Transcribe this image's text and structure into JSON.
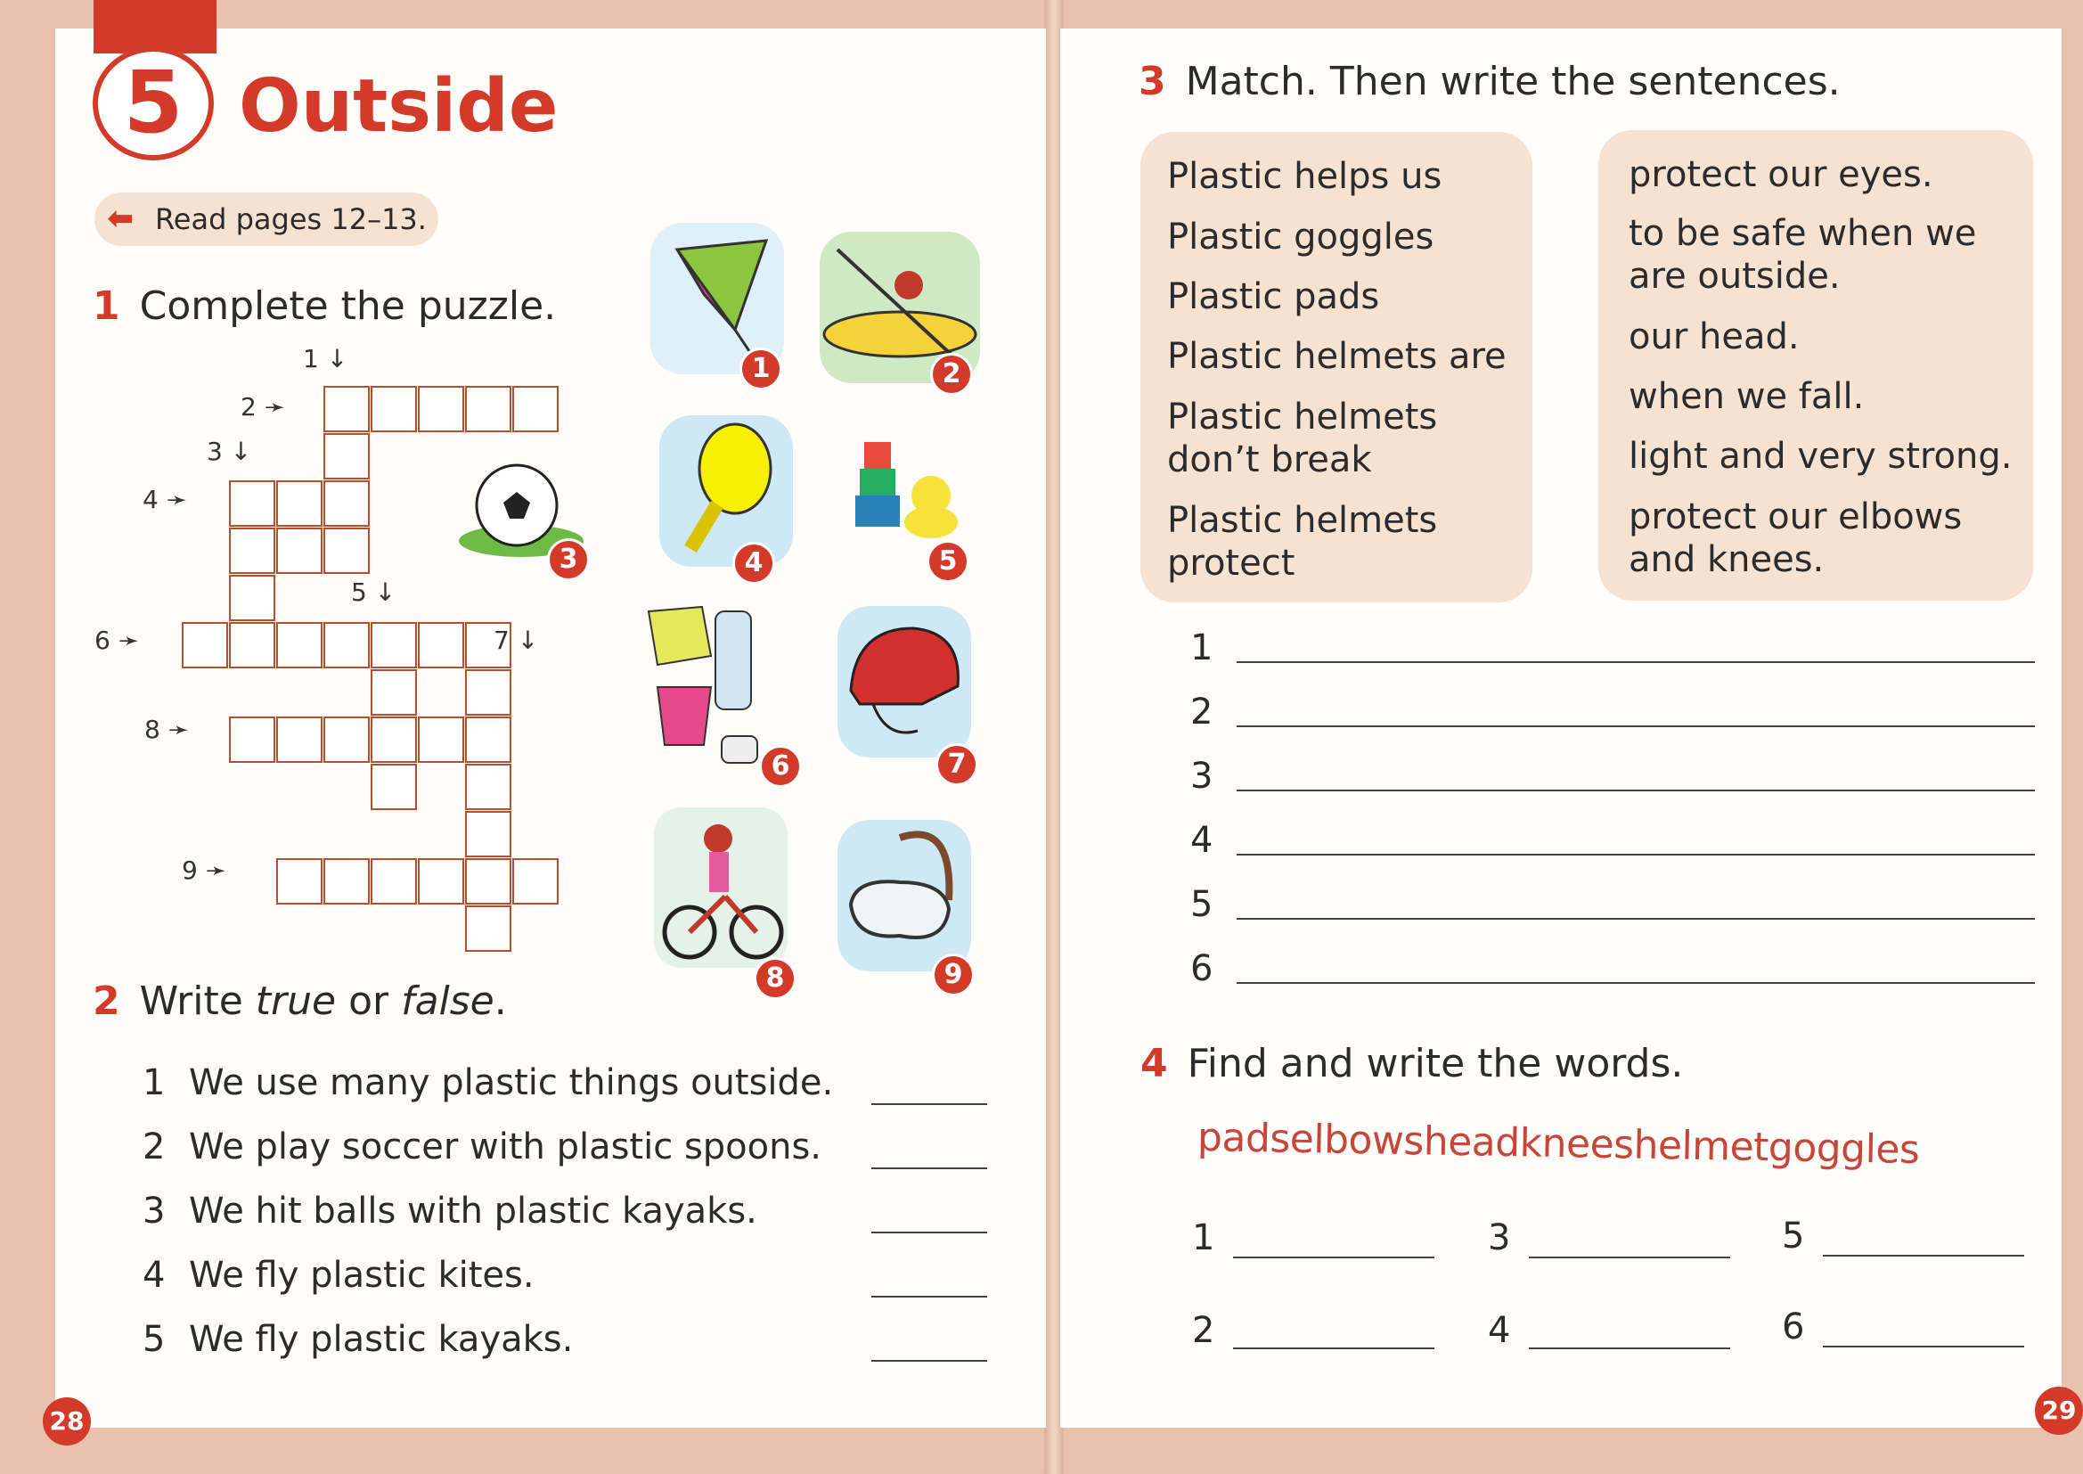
{
  "left": {
    "unit_number": "5",
    "unit_title": "Outside",
    "read_pages": "Read pages 12–13.",
    "ex1": {
      "num": "1",
      "title": "Complete the puzzle."
    },
    "clues": [
      "1",
      "2",
      "3",
      "4",
      "5",
      "6",
      "7",
      "8",
      "9"
    ],
    "pictures": [
      "1",
      "2",
      "3",
      "4",
      "5",
      "6",
      "7",
      "8",
      "9"
    ],
    "ex2": {
      "num": "2",
      "title_a": "Write ",
      "title_true": "true",
      "title_or": " or ",
      "title_false": "false",
      "title_end": "."
    },
    "statements": [
      {
        "n": "1",
        "text": "We use many plastic things outside."
      },
      {
        "n": "2",
        "text": "We play soccer with plastic spoons."
      },
      {
        "n": "3",
        "text": "We hit balls with plastic kayaks."
      },
      {
        "n": "4",
        "text": "We fly plastic kites."
      },
      {
        "n": "5",
        "text": "We fly plastic kayaks."
      }
    ],
    "page_number": "28"
  },
  "right": {
    "ex3": {
      "num": "3",
      "title": "Match. Then write the sentences."
    },
    "left_column": [
      "Plastic helps us",
      "Plastic goggles",
      "Plastic pads",
      "Plastic helmets are",
      "Plastic helmets\ndon’t break",
      "Plastic helmets\nprotect"
    ],
    "right_column": [
      "protect our eyes.",
      "to be safe when we\nare outside.",
      "our head.",
      "when we fall.",
      "light and very strong.",
      "protect our elbows\nand knees."
    ],
    "write_numbers": [
      "1",
      "2",
      "3",
      "4",
      "5",
      "6"
    ],
    "ex4": {
      "num": "4",
      "title": "Find and write the words."
    },
    "word_snake": "padselbowsheadkneeshelmetgoggles",
    "find_numbers": [
      "1",
      "3",
      "5",
      "2",
      "4",
      "6"
    ],
    "page_number": "29"
  },
  "colors": {
    "accent": "#d43a2a",
    "box": "#f7e2d2",
    "background": "#e9c2ad"
  },
  "icons": [
    "kite-icon",
    "kayak-icon",
    "soccer-ball-icon",
    "paddle-icon",
    "toys-icon",
    "plastic-trash-icon",
    "helmet-icon",
    "cyclist-icon",
    "goggles-icon"
  ]
}
